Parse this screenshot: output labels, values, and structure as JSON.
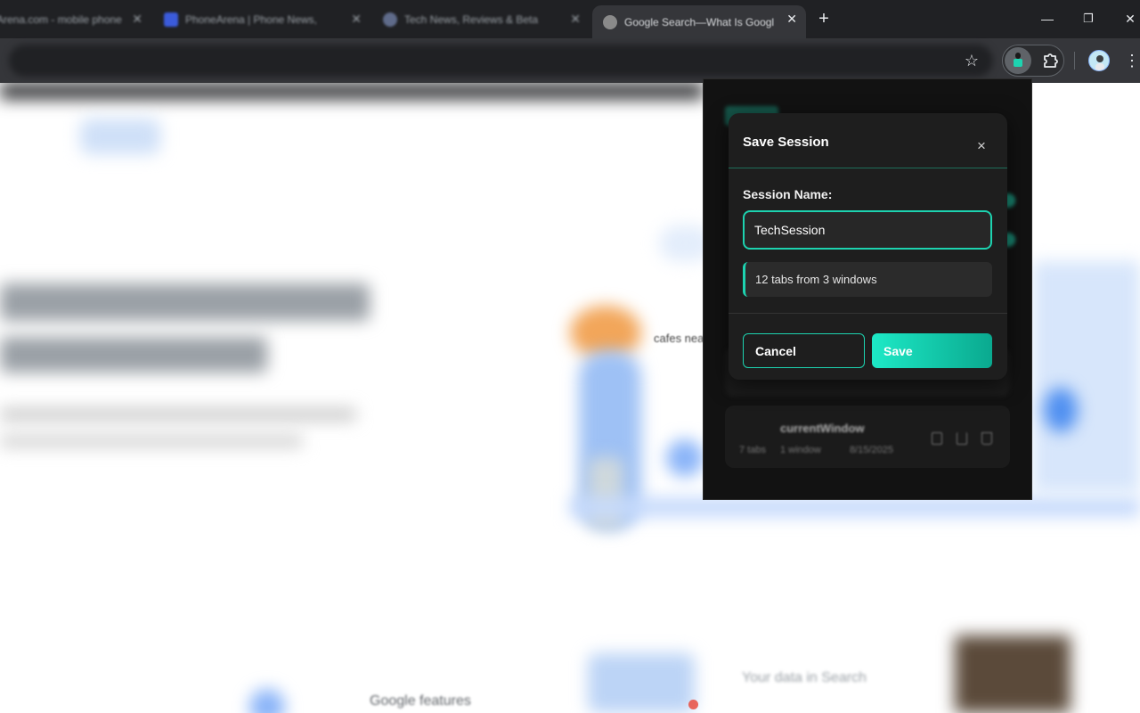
{
  "tabs": [
    {
      "title": "Arena.com - mobile phone",
      "favicon_color": "#4a4a4a"
    },
    {
      "title": "PhoneArena | Phone News, Re",
      "favicon_color": "#3b5bdb"
    },
    {
      "title": "Tech News, Reviews & Betas | ",
      "favicon_color": "#5f6b8a"
    },
    {
      "title": "Google Search—What Is Googl",
      "favicon_color": "#8a8a8a",
      "active": true
    }
  ],
  "window_controls": {
    "new_tab": "+",
    "minimize": "—",
    "maximize": "❐",
    "close": "✕"
  },
  "toolbar": {
    "star_icon": "star-icon",
    "menu_glyph": "⋮"
  },
  "page": {
    "bubble_text": "cafes nea",
    "features_heading": "Google features",
    "data_heading": "Your data in Search"
  },
  "popup_background": {
    "session_card_title": "currentWindow",
    "session_card_tabs": "7 tabs",
    "session_card_windows": "1 window",
    "session_card_date": "8/15/2025"
  },
  "modal": {
    "title": "Save Session",
    "close_glyph": "×",
    "field_label": "Session Name:",
    "name_value": "TechSession",
    "info_text": "12 tabs from 3 windows",
    "cancel_label": "Cancel",
    "save_label": "Save"
  },
  "colors": {
    "accent": "#1dd3b0",
    "modal_bg": "#1e1e1e",
    "popup_bg": "#121212",
    "chrome_bg": "#202124",
    "toolbar_bg": "#35363a"
  }
}
